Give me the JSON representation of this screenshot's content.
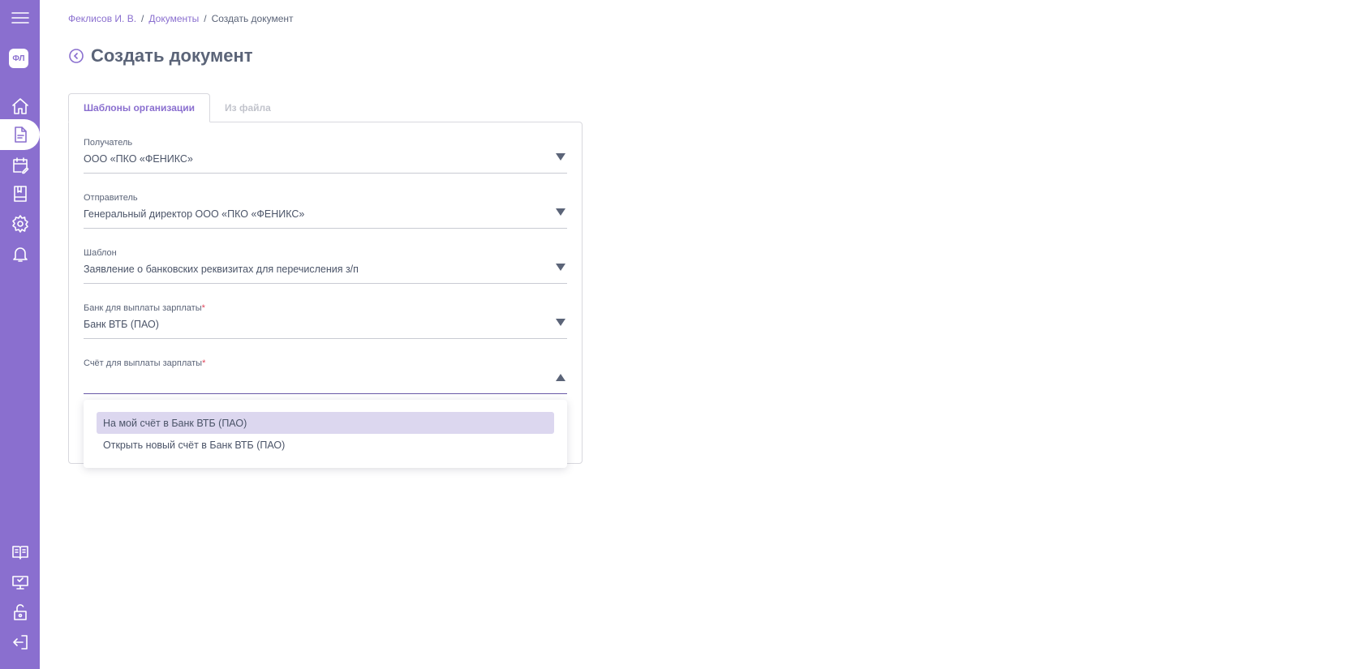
{
  "sidebar": {
    "avatar_text": "ФЛ",
    "accent": "#8a6fcf",
    "top_icons": [
      "menu-icon",
      "home-icon",
      "document-icon",
      "calendar-edit-icon",
      "bookmark-book-icon",
      "gear-icon",
      "bell-icon"
    ],
    "bottom_icons": [
      "book-icon",
      "monitor-icon",
      "unlock-icon",
      "logout-icon"
    ]
  },
  "breadcrumb": {
    "items": [
      "Феклисов И. В.",
      "Документы",
      "Создать документ"
    ],
    "separator": "/"
  },
  "page": {
    "title": "Создать документ"
  },
  "tabs": [
    {
      "label": "Шаблоны организации",
      "active": true
    },
    {
      "label": "Из файла",
      "active": false
    }
  ],
  "form": {
    "recipient": {
      "label": "Получатель",
      "value": "ООО «ПКО «ФЕНИКС»"
    },
    "sender": {
      "label": "Отправитель",
      "value": "Генеральный директор ООО «ПКО «ФЕНИКС»"
    },
    "template": {
      "label": "Шаблон",
      "value": "Заявление о банковских реквизитах для перечисления з/п"
    },
    "bank": {
      "label": "Банк для выплаты зарплаты",
      "required_mark": "*",
      "value": "Банк ВТБ (ПАО)"
    },
    "account": {
      "label": "Счёт для выплаты зарплаты",
      "required_mark": "*",
      "value": ""
    }
  },
  "dropdown": {
    "options": [
      "На мой счёт в Банк ВТБ (ПАО)",
      "Открыть новый счёт в Банк ВТБ (ПАО)"
    ],
    "highlighted_index": 0
  }
}
